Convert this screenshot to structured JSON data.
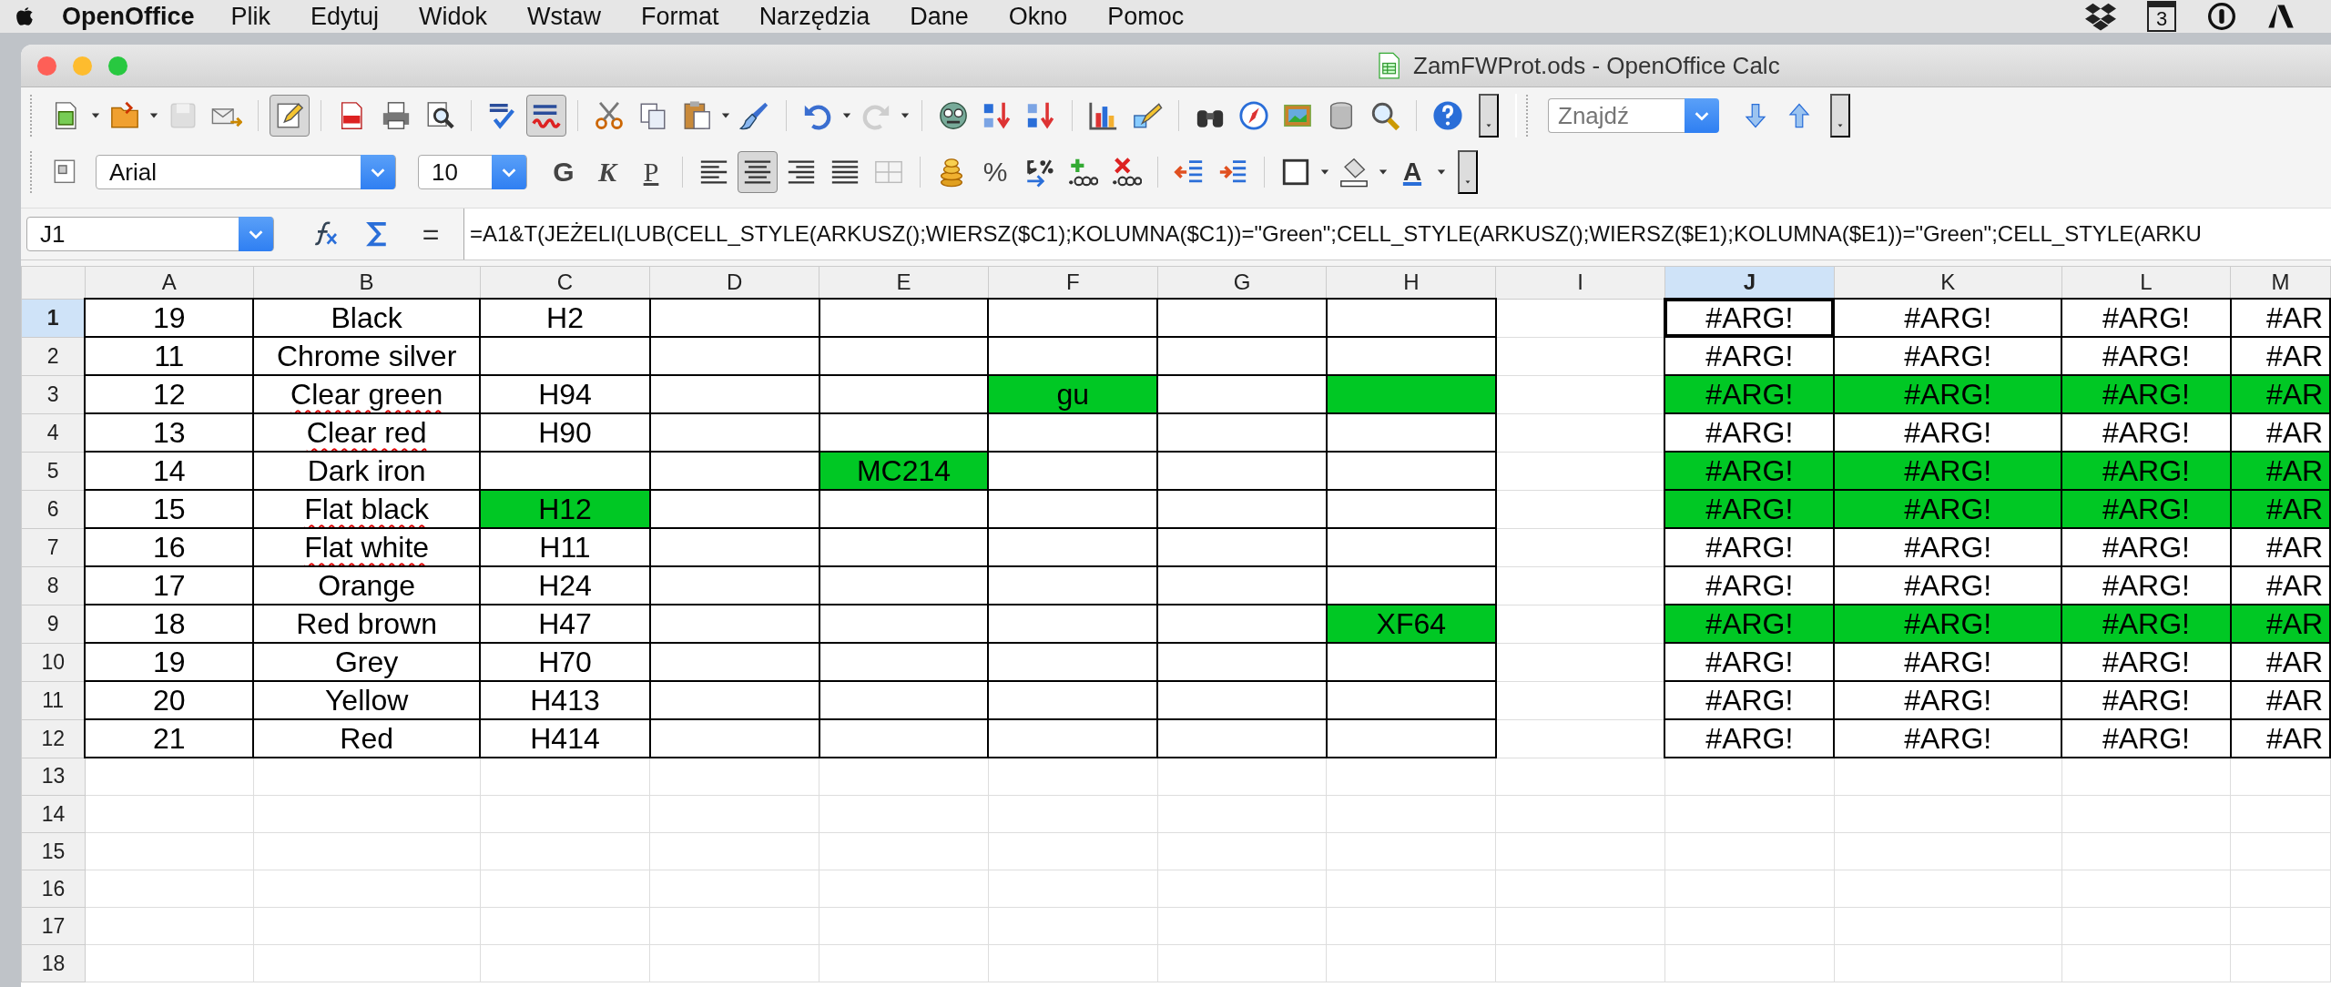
{
  "menu_bar": {
    "app_name": "OpenOffice",
    "items": [
      "Plik",
      "Edytuj",
      "Widok",
      "Wstaw",
      "Format",
      "Narzędzia",
      "Dane",
      "Okno",
      "Pomoc"
    ],
    "calendar_day": "3"
  },
  "window": {
    "title": "ZamFWProt.ods - OpenOffice Calc"
  },
  "toolbar_standard": [
    {
      "kind": "new",
      "dropdown": true,
      "pressed": false,
      "disabled": false
    },
    {
      "kind": "open",
      "dropdown": true,
      "pressed": false,
      "disabled": false
    },
    {
      "kind": "save",
      "dropdown": false,
      "pressed": false,
      "disabled": true
    },
    {
      "kind": "mail",
      "dropdown": false,
      "pressed": false,
      "disabled": false
    },
    {
      "kind": "sep"
    },
    {
      "kind": "edit",
      "dropdown": false,
      "pressed": true,
      "disabled": false
    },
    {
      "kind": "sep"
    },
    {
      "kind": "pdf",
      "dropdown": false,
      "pressed": false,
      "disabled": false
    },
    {
      "kind": "print",
      "dropdown": false,
      "pressed": false,
      "disabled": false
    },
    {
      "kind": "preview",
      "dropdown": false,
      "pressed": false,
      "disabled": false
    },
    {
      "kind": "sep"
    },
    {
      "kind": "spell",
      "dropdown": false,
      "pressed": false,
      "disabled": false
    },
    {
      "kind": "autospell",
      "dropdown": false,
      "pressed": true,
      "disabled": false
    },
    {
      "kind": "sep"
    },
    {
      "kind": "cut",
      "dropdown": false,
      "pressed": false,
      "disabled": false
    },
    {
      "kind": "copy",
      "dropdown": false,
      "pressed": false,
      "disabled": false
    },
    {
      "kind": "paste",
      "dropdown": true,
      "pressed": false,
      "disabled": false
    },
    {
      "kind": "clone",
      "dropdown": false,
      "pressed": false,
      "disabled": false
    },
    {
      "kind": "sep"
    },
    {
      "kind": "undo",
      "dropdown": true,
      "pressed": false,
      "disabled": false
    },
    {
      "kind": "redo",
      "dropdown": true,
      "pressed": false,
      "disabled": true
    },
    {
      "kind": "sep"
    },
    {
      "kind": "round",
      "dropdown": false,
      "pressed": false,
      "disabled": false
    },
    {
      "kind": "sortasc",
      "dropdown": false,
      "pressed": false,
      "disabled": false
    },
    {
      "kind": "sortdesc",
      "dropdown": false,
      "pressed": false,
      "disabled": false
    },
    {
      "kind": "sep"
    },
    {
      "kind": "chart",
      "dropdown": false,
      "pressed": false,
      "disabled": false
    },
    {
      "kind": "draw",
      "dropdown": false,
      "pressed": false,
      "disabled": false
    },
    {
      "kind": "sep"
    },
    {
      "kind": "binoculars",
      "dropdown": false,
      "pressed": false,
      "disabled": false
    },
    {
      "kind": "compass",
      "dropdown": false,
      "pressed": false,
      "disabled": false
    },
    {
      "kind": "gallery",
      "dropdown": false,
      "pressed": false,
      "disabled": false
    },
    {
      "kind": "database",
      "dropdown": false,
      "pressed": false,
      "disabled": false
    },
    {
      "kind": "zoom",
      "dropdown": false,
      "pressed": false,
      "disabled": false
    },
    {
      "kind": "sep"
    },
    {
      "kind": "help",
      "dropdown": false,
      "pressed": false,
      "disabled": false
    },
    {
      "kind": "more"
    }
  ],
  "find_toolbar": {
    "placeholder": "Znajdź"
  },
  "toolbar_formatting": [
    {
      "kind": "styles",
      "dropdown": false,
      "pressed": false
    },
    {
      "kind": "font_name",
      "value": "Arial"
    },
    {
      "kind": "font_size",
      "value": "10"
    },
    {
      "kind": "bold",
      "label": "G",
      "pressed": false
    },
    {
      "kind": "italic",
      "label": "K",
      "pressed": false
    },
    {
      "kind": "underline",
      "label": "P",
      "pressed": false
    },
    {
      "kind": "sep"
    },
    {
      "kind": "alignleft",
      "dropdown": false,
      "pressed": false
    },
    {
      "kind": "aligncenter",
      "dropdown": false,
      "pressed": true
    },
    {
      "kind": "alignright",
      "dropdown": false,
      "pressed": false
    },
    {
      "kind": "justify",
      "dropdown": false,
      "pressed": false
    },
    {
      "kind": "merge",
      "dropdown": false,
      "pressed": false
    },
    {
      "kind": "sep"
    },
    {
      "kind": "currency",
      "dropdown": false,
      "pressed": false
    },
    {
      "kind": "percent",
      "label": "%",
      "pressed": false
    },
    {
      "kind": "standard",
      "dropdown": false,
      "pressed": false
    },
    {
      "kind": "adddecimal",
      "dropdown": false,
      "pressed": false
    },
    {
      "kind": "deldecimal",
      "dropdown": false,
      "pressed": false
    },
    {
      "kind": "sep"
    },
    {
      "kind": "outdent",
      "dropdown": false,
      "pressed": false
    },
    {
      "kind": "indent",
      "dropdown": false,
      "pressed": false
    },
    {
      "kind": "sep"
    },
    {
      "kind": "borders",
      "dropdown": true,
      "pressed": false
    },
    {
      "kind": "bgcolor",
      "dropdown": true,
      "pressed": false
    },
    {
      "kind": "fontcolor",
      "label": "A",
      "dropdown": true,
      "pressed": false
    },
    {
      "kind": "more"
    }
  ],
  "formula_bar": {
    "name_box": "J1",
    "equals": "=",
    "formula": "=A1&T(JEŻELI(LUB(CELL_STYLE(ARKUSZ();WIERSZ($C1);KOLUMNA($C1))=\"Green\";CELL_STYLE(ARKUSZ();WIERSZ($E1);KOLUMNA($E1))=\"Green\";CELL_STYLE(ARKU"
  },
  "sheet": {
    "columns": [
      {
        "label": "A",
        "selected": false
      },
      {
        "label": "B",
        "selected": false
      },
      {
        "label": "C",
        "selected": false
      },
      {
        "label": "D",
        "selected": false
      },
      {
        "label": "E",
        "selected": false
      },
      {
        "label": "F",
        "selected": false
      },
      {
        "label": "G",
        "selected": false
      },
      {
        "label": "H",
        "selected": false
      },
      {
        "label": "I",
        "selected": false
      },
      {
        "label": "J",
        "selected": true
      },
      {
        "label": "K",
        "selected": false
      },
      {
        "label": "L",
        "selected": false
      },
      {
        "label": "M",
        "selected": false
      }
    ],
    "rows": [
      {
        "number": "1",
        "selected": true,
        "cells": [
          {
            "text": "19",
            "highlighted": false,
            "bordered": true
          },
          {
            "text": "Black",
            "highlighted": false,
            "bordered": true
          },
          {
            "text": "H2",
            "highlighted": false,
            "bordered": true
          },
          {
            "highlighted": false,
            "bordered": true
          },
          {
            "highlighted": false,
            "bordered": true
          },
          {
            "highlighted": false,
            "bordered": true
          },
          {
            "highlighted": false,
            "bordered": true
          },
          {
            "highlighted": false,
            "bordered": true
          },
          {
            "highlighted": false,
            "bordered": false
          },
          {
            "text": "#ARG!",
            "highlighted": false,
            "bordered": true
          },
          {
            "text": "#ARG!",
            "highlighted": false,
            "bordered": true
          },
          {
            "text": "#ARG!",
            "highlighted": false,
            "bordered": true
          },
          {
            "text": "#AR",
            "highlighted": false,
            "bordered": true
          }
        ]
      },
      {
        "number": "2",
        "selected": false,
        "cells": [
          {
            "text": "11",
            "highlighted": false,
            "bordered": true
          },
          {
            "text": "Chrome silver",
            "highlighted": false,
            "bordered": true
          },
          {
            "highlighted": false,
            "bordered": true
          },
          {
            "highlighted": false,
            "bordered": true
          },
          {
            "highlighted": false,
            "bordered": true
          },
          {
            "highlighted": false,
            "bordered": true
          },
          {
            "highlighted": false,
            "bordered": true
          },
          {
            "highlighted": false,
            "bordered": true
          },
          {
            "highlighted": false,
            "bordered": false
          },
          {
            "text": "#ARG!",
            "highlighted": false,
            "bordered": true
          },
          {
            "text": "#ARG!",
            "highlighted": false,
            "bordered": true
          },
          {
            "text": "#ARG!",
            "highlighted": false,
            "bordered": true
          },
          {
            "text": "#AR",
            "highlighted": false,
            "bordered": true
          }
        ]
      },
      {
        "number": "3",
        "selected": false,
        "cells": [
          {
            "text": "12",
            "highlighted": false,
            "bordered": true
          },
          {
            "text": "Clear green",
            "spell_error": true,
            "highlighted": false,
            "bordered": true
          },
          {
            "text": "H94",
            "highlighted": false,
            "bordered": true
          },
          {
            "highlighted": false,
            "bordered": true
          },
          {
            "highlighted": false,
            "bordered": true
          },
          {
            "text": "gu",
            "highlighted": true,
            "bordered": true
          },
          {
            "highlighted": false,
            "bordered": true
          },
          {
            "highlighted": true,
            "bordered": true
          },
          {
            "highlighted": false,
            "bordered": false
          },
          {
            "text": "#ARG!",
            "highlighted": true,
            "bordered": true
          },
          {
            "text": "#ARG!",
            "highlighted": true,
            "bordered": true
          },
          {
            "text": "#ARG!",
            "highlighted": true,
            "bordered": true
          },
          {
            "text": "#AR",
            "highlighted": true,
            "bordered": true
          }
        ]
      },
      {
        "number": "4",
        "selected": false,
        "cells": [
          {
            "text": "13",
            "highlighted": false,
            "bordered": true
          },
          {
            "text": "Clear red",
            "spell_error": true,
            "highlighted": false,
            "bordered": true
          },
          {
            "text": "H90",
            "highlighted": false,
            "bordered": true
          },
          {
            "highlighted": false,
            "bordered": true
          },
          {
            "highlighted": false,
            "bordered": true
          },
          {
            "highlighted": false,
            "bordered": true
          },
          {
            "highlighted": false,
            "bordered": true
          },
          {
            "highlighted": false,
            "bordered": true
          },
          {
            "highlighted": false,
            "bordered": false
          },
          {
            "text": "#ARG!",
            "highlighted": false,
            "bordered": true
          },
          {
            "text": "#ARG!",
            "highlighted": false,
            "bordered": true
          },
          {
            "text": "#ARG!",
            "highlighted": false,
            "bordered": true
          },
          {
            "text": "#AR",
            "highlighted": false,
            "bordered": true
          }
        ]
      },
      {
        "number": "5",
        "selected": false,
        "cells": [
          {
            "text": "14",
            "highlighted": false,
            "bordered": true
          },
          {
            "text": "Dark iron",
            "highlighted": false,
            "bordered": true
          },
          {
            "highlighted": false,
            "bordered": true
          },
          {
            "highlighted": false,
            "bordered": true
          },
          {
            "text": "MC214",
            "highlighted": true,
            "bordered": true
          },
          {
            "highlighted": false,
            "bordered": true
          },
          {
            "highlighted": false,
            "bordered": true
          },
          {
            "highlighted": false,
            "bordered": true
          },
          {
            "highlighted": false,
            "bordered": false
          },
          {
            "text": "#ARG!",
            "highlighted": true,
            "bordered": true
          },
          {
            "text": "#ARG!",
            "highlighted": true,
            "bordered": true
          },
          {
            "text": "#ARG!",
            "highlighted": true,
            "bordered": true
          },
          {
            "text": "#AR",
            "highlighted": true,
            "bordered": true
          }
        ]
      },
      {
        "number": "6",
        "selected": false,
        "cells": [
          {
            "text": "15",
            "highlighted": false,
            "bordered": true
          },
          {
            "text": "Flat black",
            "spell_error": true,
            "highlighted": false,
            "bordered": true
          },
          {
            "text": "H12",
            "highlighted": true,
            "bordered": true
          },
          {
            "highlighted": false,
            "bordered": true
          },
          {
            "highlighted": false,
            "bordered": true
          },
          {
            "highlighted": false,
            "bordered": true
          },
          {
            "highlighted": false,
            "bordered": true
          },
          {
            "highlighted": false,
            "bordered": true
          },
          {
            "highlighted": false,
            "bordered": false
          },
          {
            "text": "#ARG!",
            "highlighted": true,
            "bordered": true
          },
          {
            "text": "#ARG!",
            "highlighted": true,
            "bordered": true
          },
          {
            "text": "#ARG!",
            "highlighted": true,
            "bordered": true
          },
          {
            "text": "#AR",
            "highlighted": true,
            "bordered": true
          }
        ]
      },
      {
        "number": "7",
        "selected": false,
        "cells": [
          {
            "text": "16",
            "highlighted": false,
            "bordered": true
          },
          {
            "text": "Flat white",
            "spell_error": true,
            "highlighted": false,
            "bordered": true
          },
          {
            "text": "H11",
            "highlighted": false,
            "bordered": true
          },
          {
            "highlighted": false,
            "bordered": true
          },
          {
            "highlighted": false,
            "bordered": true
          },
          {
            "highlighted": false,
            "bordered": true
          },
          {
            "highlighted": false,
            "bordered": true
          },
          {
            "highlighted": false,
            "bordered": true
          },
          {
            "highlighted": false,
            "bordered": false
          },
          {
            "text": "#ARG!",
            "highlighted": false,
            "bordered": true
          },
          {
            "text": "#ARG!",
            "highlighted": false,
            "bordered": true
          },
          {
            "text": "#ARG!",
            "highlighted": false,
            "bordered": true
          },
          {
            "text": "#AR",
            "highlighted": false,
            "bordered": true
          }
        ]
      },
      {
        "number": "8",
        "selected": false,
        "cells": [
          {
            "text": "17",
            "highlighted": false,
            "bordered": true
          },
          {
            "text": "Orange",
            "highlighted": false,
            "bordered": true
          },
          {
            "text": "H24",
            "highlighted": false,
            "bordered": true
          },
          {
            "highlighted": false,
            "bordered": true
          },
          {
            "highlighted": false,
            "bordered": true
          },
          {
            "highlighted": false,
            "bordered": true
          },
          {
            "highlighted": false,
            "bordered": true
          },
          {
            "highlighted": false,
            "bordered": true
          },
          {
            "highlighted": false,
            "bordered": false
          },
          {
            "text": "#ARG!",
            "highlighted": false,
            "bordered": true
          },
          {
            "text": "#ARG!",
            "highlighted": false,
            "bordered": true
          },
          {
            "text": "#ARG!",
            "highlighted": false,
            "bordered": true
          },
          {
            "text": "#AR",
            "highlighted": false,
            "bordered": true
          }
        ]
      },
      {
        "number": "9",
        "selected": false,
        "cells": [
          {
            "text": "18",
            "highlighted": false,
            "bordered": true
          },
          {
            "text": "Red brown",
            "highlighted": false,
            "bordered": true
          },
          {
            "text": "H47",
            "highlighted": false,
            "bordered": true
          },
          {
            "highlighted": false,
            "bordered": true
          },
          {
            "highlighted": false,
            "bordered": true
          },
          {
            "highlighted": false,
            "bordered": true
          },
          {
            "highlighted": false,
            "bordered": true
          },
          {
            "text": "XF64",
            "highlighted": true,
            "bordered": true
          },
          {
            "highlighted": false,
            "bordered": false
          },
          {
            "text": "#ARG!",
            "highlighted": true,
            "bordered": true
          },
          {
            "text": "#ARG!",
            "highlighted": true,
            "bordered": true
          },
          {
            "text": "#ARG!",
            "highlighted": true,
            "bordered": true
          },
          {
            "text": "#AR",
            "highlighted": true,
            "bordered": true
          }
        ]
      },
      {
        "number": "10",
        "selected": false,
        "cells": [
          {
            "text": "19",
            "highlighted": false,
            "bordered": true
          },
          {
            "text": "Grey",
            "highlighted": false,
            "bordered": true
          },
          {
            "text": "H70",
            "highlighted": false,
            "bordered": true
          },
          {
            "highlighted": false,
            "bordered": true
          },
          {
            "highlighted": false,
            "bordered": true
          },
          {
            "highlighted": false,
            "bordered": true
          },
          {
            "highlighted": false,
            "bordered": true
          },
          {
            "highlighted": false,
            "bordered": true
          },
          {
            "highlighted": false,
            "bordered": false
          },
          {
            "text": "#ARG!",
            "highlighted": false,
            "bordered": true
          },
          {
            "text": "#ARG!",
            "highlighted": false,
            "bordered": true
          },
          {
            "text": "#ARG!",
            "highlighted": false,
            "bordered": true
          },
          {
            "text": "#AR",
            "highlighted": false,
            "bordered": true
          }
        ]
      },
      {
        "number": "11",
        "selected": false,
        "cells": [
          {
            "text": "20",
            "highlighted": false,
            "bordered": true
          },
          {
            "text": "Yellow",
            "highlighted": false,
            "bordered": true
          },
          {
            "text": "H413",
            "highlighted": false,
            "bordered": true
          },
          {
            "highlighted": false,
            "bordered": true
          },
          {
            "highlighted": false,
            "bordered": true
          },
          {
            "highlighted": false,
            "bordered": true
          },
          {
            "highlighted": false,
            "bordered": true
          },
          {
            "highlighted": false,
            "bordered": true
          },
          {
            "highlighted": false,
            "bordered": false
          },
          {
            "text": "#ARG!",
            "highlighted": false,
            "bordered": true
          },
          {
            "text": "#ARG!",
            "highlighted": false,
            "bordered": true
          },
          {
            "text": "#ARG!",
            "highlighted": false,
            "bordered": true
          },
          {
            "text": "#AR",
            "highlighted": false,
            "bordered": true
          }
        ]
      },
      {
        "number": "12",
        "selected": false,
        "cells": [
          {
            "text": "21",
            "highlighted": false,
            "bordered": true
          },
          {
            "text": "Red",
            "highlighted": false,
            "bordered": true
          },
          {
            "text": "H414",
            "highlighted": false,
            "bordered": true
          },
          {
            "highlighted": false,
            "bordered": true
          },
          {
            "highlighted": false,
            "bordered": true
          },
          {
            "highlighted": false,
            "bordered": true
          },
          {
            "highlighted": false,
            "bordered": true
          },
          {
            "highlighted": false,
            "bordered": true
          },
          {
            "highlighted": false,
            "bordered": false
          },
          {
            "text": "#ARG!",
            "highlighted": false,
            "bordered": true
          },
          {
            "text": "#ARG!",
            "highlighted": false,
            "bordered": true
          },
          {
            "text": "#ARG!",
            "highlighted": false,
            "bordered": true
          },
          {
            "text": "#AR",
            "highlighted": false,
            "bordered": true
          }
        ]
      },
      {
        "number": "13",
        "selected": false
      },
      {
        "number": "14",
        "selected": false
      },
      {
        "number": "15",
        "selected": false
      },
      {
        "number": "16",
        "selected": false
      },
      {
        "number": "17",
        "selected": false
      },
      {
        "number": "18",
        "selected": false
      }
    ]
  }
}
